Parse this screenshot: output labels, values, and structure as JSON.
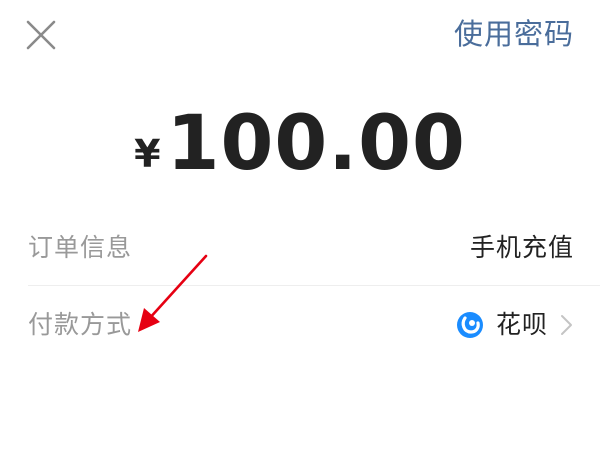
{
  "header": {
    "close_icon": "close-icon",
    "use_password_label": "使用密码"
  },
  "amount": {
    "currency": "¥",
    "value": "100.00"
  },
  "order_info": {
    "label": "订单信息",
    "value": "手机充值"
  },
  "payment_method": {
    "label": "付款方式",
    "method_name": "花呗",
    "method_icon": "huabei-icon",
    "chevron_icon": "chevron-right-icon"
  },
  "colors": {
    "accent_blue": "#4a6d9b",
    "huabei_blue": "#1a8cff",
    "label_gray": "#999999",
    "text_dark": "#222222",
    "annotation_red": "#e60012"
  }
}
